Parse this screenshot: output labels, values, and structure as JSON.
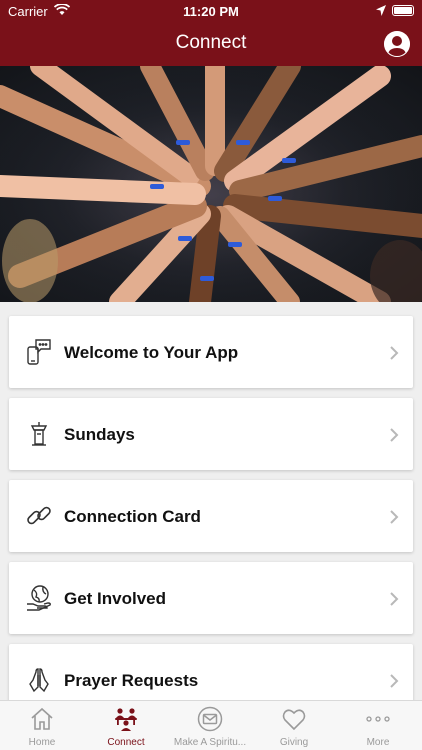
{
  "status_bar": {
    "carrier": "Carrier",
    "time": "11:20 PM"
  },
  "nav": {
    "title": "Connect",
    "profile_icon": "person-icon"
  },
  "hero": {
    "description_icon": "hands-together-photo"
  },
  "list": {
    "items": [
      {
        "label": "Welcome to Your App",
        "icon": "phone-message-icon"
      },
      {
        "label": "Sundays",
        "icon": "pulpit-icon"
      },
      {
        "label": "Connection Card",
        "icon": "link-icon"
      },
      {
        "label": "Get Involved",
        "icon": "globe-hand-icon"
      },
      {
        "label": "Prayer Requests",
        "icon": "praying-hands-icon"
      }
    ]
  },
  "tabs": {
    "items": [
      {
        "label": "Home",
        "icon": "home-icon",
        "active": false
      },
      {
        "label": "Connect",
        "icon": "group-icon",
        "active": true
      },
      {
        "label": "Make A Spiritu...",
        "icon": "envelope-icon",
        "active": false
      },
      {
        "label": "Giving",
        "icon": "heart-icon",
        "active": false
      },
      {
        "label": "More",
        "icon": "more-dots-icon",
        "active": false
      }
    ]
  },
  "colors": {
    "brand": "#7a1119",
    "tab_inactive": "#9a9a9a",
    "background": "#efefef"
  }
}
